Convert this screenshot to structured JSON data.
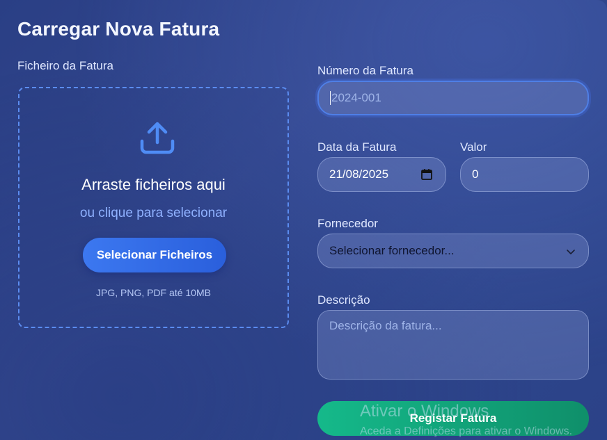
{
  "header": {
    "title": "Carregar Nova Fatura"
  },
  "upload": {
    "label": "Ficheiro da Fatura",
    "icon": "upload-icon",
    "title": "Arraste ficheiros aqui",
    "subtitle": "ou clique para selecionar",
    "button_label": "Selecionar Ficheiros",
    "hint": "JPG, PNG, PDF até 10MB"
  },
  "form": {
    "invoice_number": {
      "label": "Número da Fatura",
      "placeholder": "2024-001",
      "value": ""
    },
    "invoice_date": {
      "label": "Data da Fatura",
      "value": "21/08/2025",
      "icon": "calendar-icon"
    },
    "amount": {
      "label": "Valor",
      "value": "0"
    },
    "supplier": {
      "label": "Fornecedor",
      "selected": "Selecionar fornecedor...",
      "icon": "chevron-down-icon"
    },
    "description": {
      "label": "Descrição",
      "placeholder": "Descrição da fatura..."
    },
    "submit_label": "Registar Fatura"
  },
  "overlay": {
    "watermark_title": "Ativar o Windows",
    "watermark_sub": "Aceda a Definições para ativar o Windows."
  },
  "colors": {
    "accent_blue": "#3c78f0",
    "success_green": "#15b98a",
    "dashed_border": "#5b8cf0"
  }
}
